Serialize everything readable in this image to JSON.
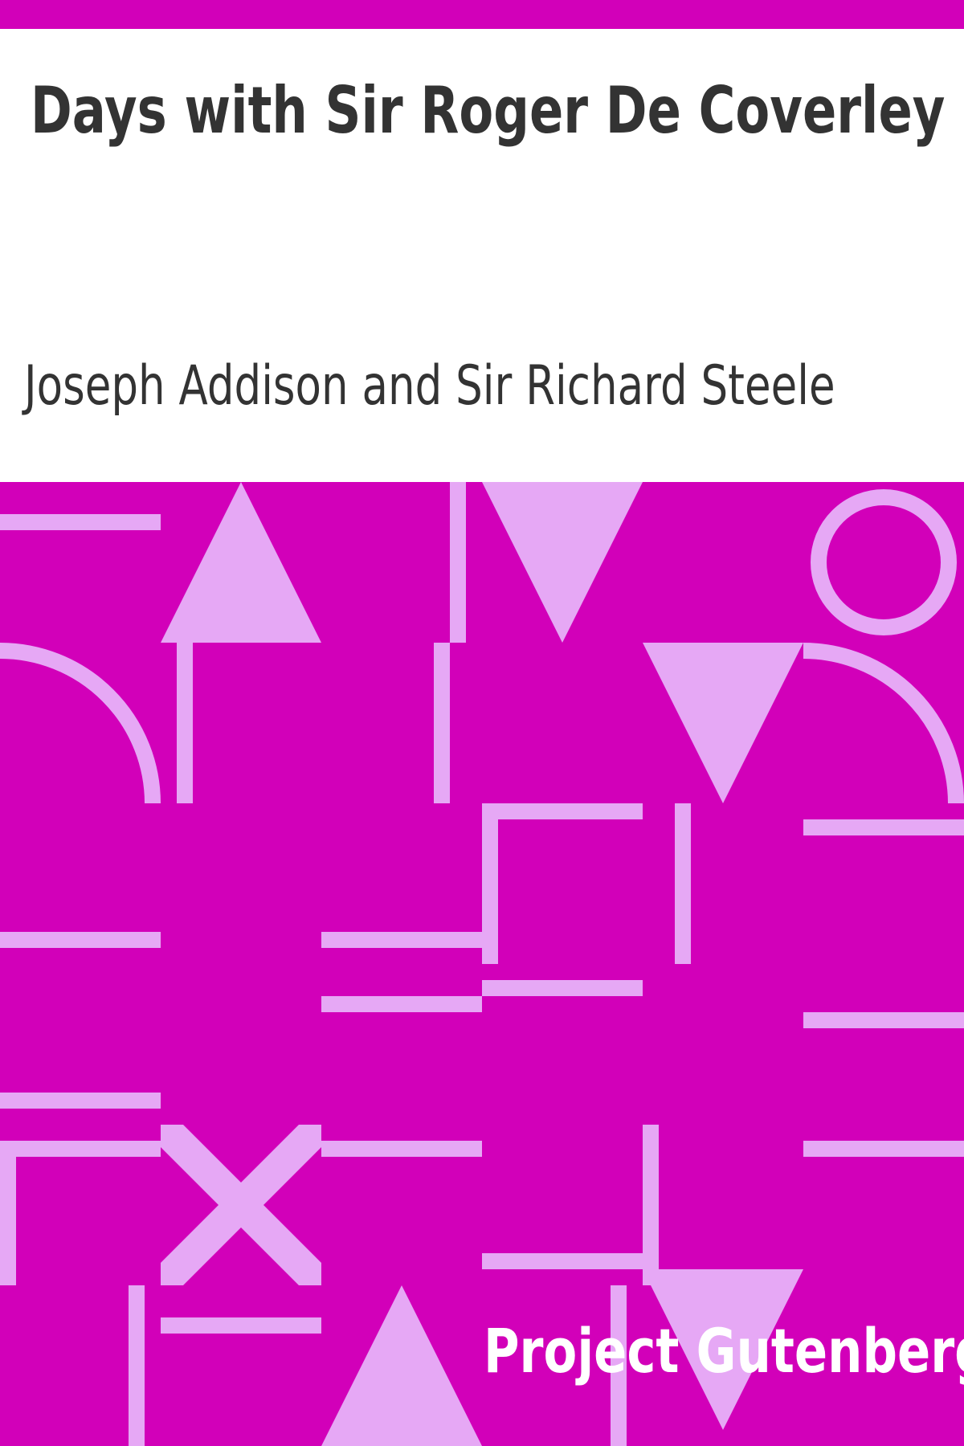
{
  "cover": {
    "title": "Days with Sir Roger De Coverley",
    "author": "Joseph Addison and Sir Richard Steele",
    "publisher": "Project Gutenberg"
  },
  "colors": {
    "background": "#d200b9",
    "pattern": "#e6a8f5",
    "header_background": "#ffffff",
    "text_dark": "#333333",
    "text_light": "#ffffff"
  }
}
